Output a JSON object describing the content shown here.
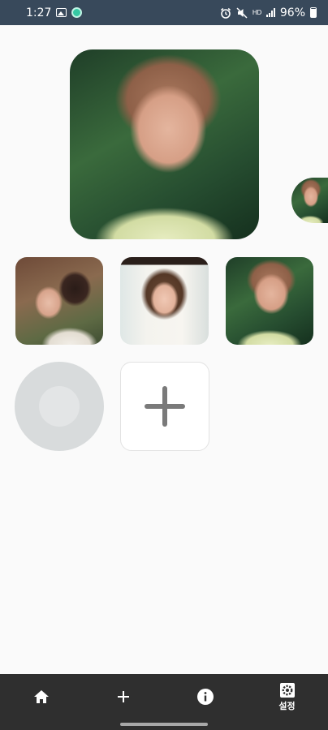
{
  "status_bar": {
    "time": "1:27",
    "network": "HD",
    "battery": "96%",
    "icons": [
      "image-icon",
      "app-notification-icon",
      "alarm-icon",
      "mute-icon",
      "signal-icon",
      "battery-icon"
    ]
  },
  "photos": {
    "main": "profile-photo-main",
    "peek": "profile-photo-next",
    "thumbnails": [
      "thumbnail-1",
      "thumbnail-2",
      "thumbnail-3"
    ]
  },
  "add_card": {
    "icon": "plus-icon"
  },
  "bottom_nav": {
    "items": [
      {
        "icon": "home-icon",
        "label": ""
      },
      {
        "icon": "plus-icon",
        "label": ""
      },
      {
        "icon": "info-icon",
        "label": ""
      },
      {
        "icon": "gear-icon",
        "label": "설정"
      }
    ]
  },
  "colors": {
    "status_bar": "#38495b",
    "background": "#fafafa",
    "nav_bar": "#2f2f2f",
    "record_outer": "#d8dbdc",
    "record_inner": "#e3e5e6",
    "plus_gray": "#7a7a7a"
  }
}
